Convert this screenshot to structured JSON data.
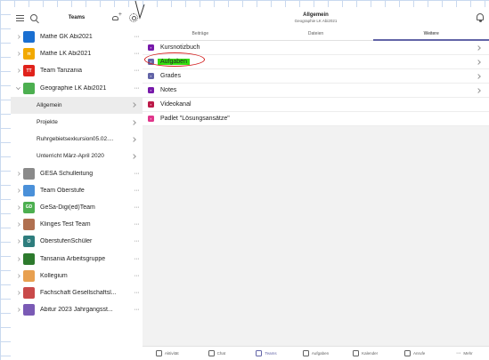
{
  "header": {
    "panel_title": "Teams",
    "channel_title": "Allgemein",
    "channel_subtitle": "Geographie LK Abi2021"
  },
  "sidebar": {
    "items": [
      {
        "type": "team",
        "label": "Mathe GK Abi2021",
        "avatar_color": "#1a6fd1",
        "avatar_text": ""
      },
      {
        "type": "team",
        "label": "Mathe LK Abi2021",
        "avatar_color": "#f2a900",
        "avatar_text": "π"
      },
      {
        "type": "team",
        "label": "Team Tanzania",
        "avatar_color": "#e0221b",
        "avatar_text": "TT"
      },
      {
        "type": "team",
        "label": "Geographie LK Abi2021",
        "avatar_color": "#4caf50",
        "avatar_text": "",
        "expanded": true
      },
      {
        "type": "channel",
        "label": "Allgemein",
        "selected": true
      },
      {
        "type": "channel",
        "label": "Projekte"
      },
      {
        "type": "channel",
        "label": "Ruhrgebietsexkursion05.02...."
      },
      {
        "type": "channel",
        "label": "Unterricht März-April 2020"
      },
      {
        "type": "team",
        "label": "GESA Schulleitung",
        "avatar_color": "#8a8a8a",
        "avatar_text": ""
      },
      {
        "type": "team",
        "label": "Team Oberstufe",
        "avatar_color": "#4a90d9",
        "avatar_text": ""
      },
      {
        "type": "team",
        "label": "GeSa-Digi(ed)Team",
        "avatar_color": "#4caf50",
        "avatar_text": "GD"
      },
      {
        "type": "team",
        "label": "Klinges Test Team",
        "avatar_color": "#b07050",
        "avatar_text": ""
      },
      {
        "type": "team",
        "label": "OberstufenSchüler",
        "avatar_color": "#2e7d7d",
        "avatar_text": "O"
      },
      {
        "type": "team",
        "label": "Tansania Arbeitsgruppe",
        "avatar_color": "#2d7a2d",
        "avatar_text": ""
      },
      {
        "type": "team",
        "label": "Kollegium",
        "avatar_color": "#e8a050",
        "avatar_text": ""
      },
      {
        "type": "team",
        "label": "Fachschaft Gesellschaftsl...",
        "avatar_color": "#c94a4a",
        "avatar_text": ""
      },
      {
        "type": "team",
        "label": "Abitur 2023 Jahrgangsst...",
        "avatar_color": "#7a5ab5",
        "avatar_text": ""
      }
    ]
  },
  "tabs": [
    {
      "label": "Beiträge",
      "active": false
    },
    {
      "label": "Dateien",
      "active": false
    },
    {
      "label": "Weitere",
      "active": true
    }
  ],
  "tab_list": [
    {
      "label": "Kursnotizbuch",
      "icon": "onenote-icon",
      "color": "#7719aa",
      "chevron": true,
      "highlight": false
    },
    {
      "label": "Aufgaben",
      "icon": "assignments-icon",
      "color": "#6264a7",
      "chevron": true,
      "highlight": true
    },
    {
      "label": "Grades",
      "icon": "grades-icon",
      "color": "#6264a7",
      "chevron": true,
      "highlight": false
    },
    {
      "label": "Notes",
      "icon": "notes-icon",
      "color": "#7719aa",
      "chevron": true,
      "highlight": false
    },
    {
      "label": "Videokanal",
      "icon": "stream-icon",
      "color": "#bc1948",
      "chevron": false,
      "highlight": false
    },
    {
      "label": "Padlet \"Lösungsansätze\"",
      "icon": "padlet-icon",
      "color": "#e0368b",
      "chevron": false,
      "highlight": false
    }
  ],
  "bottom_nav": [
    {
      "label": "Aktivität",
      "icon": "bell-icon",
      "active": false
    },
    {
      "label": "Chat",
      "icon": "chat-icon",
      "active": false
    },
    {
      "label": "Teams",
      "icon": "teams-icon",
      "active": true
    },
    {
      "label": "Aufgaben",
      "icon": "assignments-icon",
      "active": false
    },
    {
      "label": "Kalender",
      "icon": "calendar-icon",
      "active": false
    },
    {
      "label": "Anrufe",
      "icon": "phone-icon",
      "active": false
    },
    {
      "label": "Mehr",
      "icon": "more-icon",
      "active": false
    }
  ],
  "colors": {
    "accent": "#6264a7",
    "highlight": "#33e010",
    "annotation": "#d32020"
  }
}
